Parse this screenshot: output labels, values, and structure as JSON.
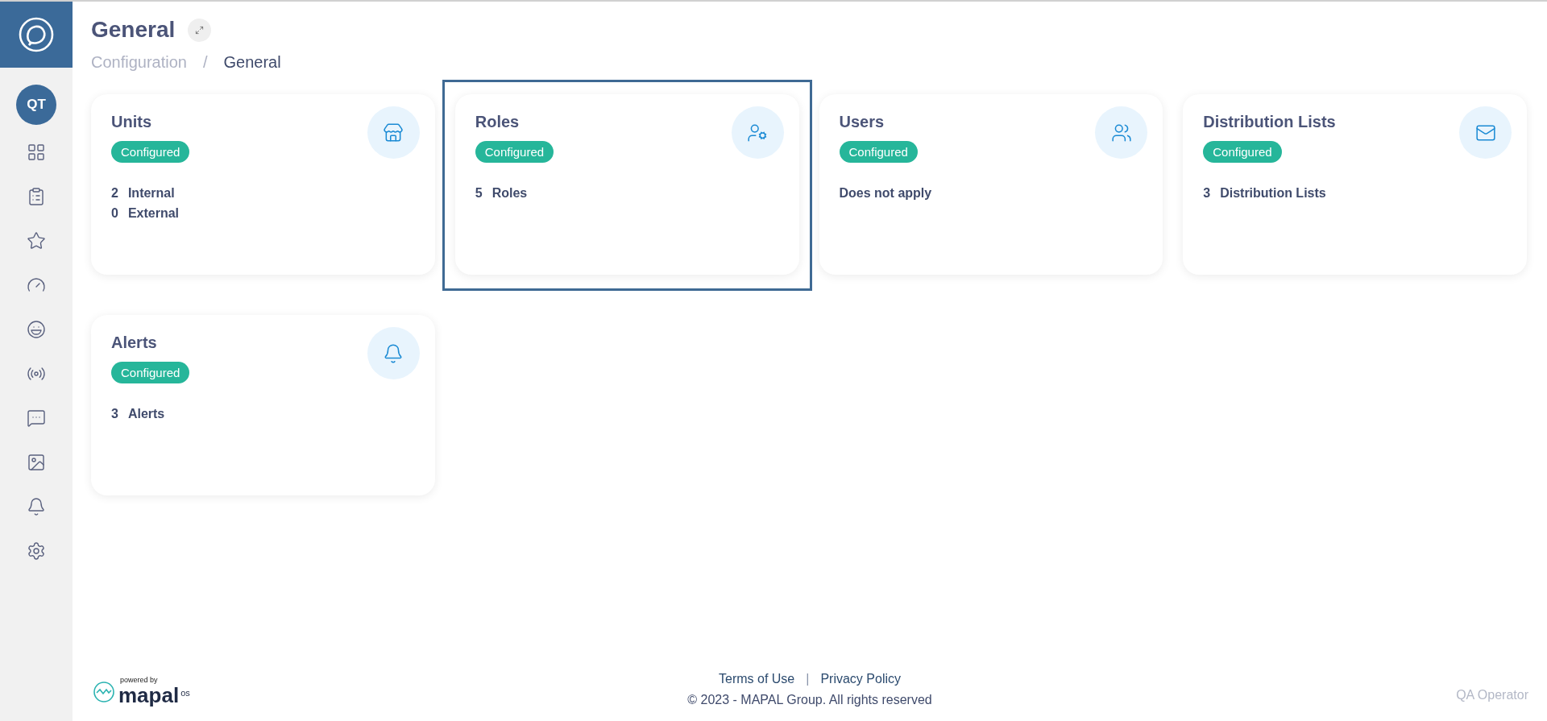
{
  "user": {
    "initials": "QT"
  },
  "header": {
    "title": "General",
    "breadcrumb": [
      {
        "label": "Configuration",
        "current": false
      },
      {
        "label": "/",
        "current": false
      },
      {
        "label": "General",
        "current": true
      }
    ]
  },
  "cards": [
    {
      "title": "Units",
      "status": "Configured",
      "selected": false,
      "lines": [
        {
          "kind": "count",
          "count": "2",
          "label": "Internal"
        },
        {
          "kind": "count",
          "count": "0",
          "label": "External"
        }
      ]
    },
    {
      "title": "Roles",
      "status": "Configured",
      "selected": true,
      "lines": [
        {
          "kind": "count",
          "count": "5",
          "label": "Roles"
        }
      ]
    },
    {
      "title": "Users",
      "status": "Configured",
      "selected": false,
      "lines": [
        {
          "kind": "note",
          "label": "Does not apply"
        }
      ]
    },
    {
      "title": "Distribution Lists",
      "status": "Configured",
      "selected": false,
      "lines": [
        {
          "kind": "count",
          "count": "3",
          "label": "Distribution Lists"
        }
      ]
    },
    {
      "title": "Alerts",
      "status": "Configured",
      "selected": false,
      "lines": [
        {
          "kind": "count",
          "count": "3",
          "label": "Alerts"
        }
      ]
    }
  ],
  "footer": {
    "powered_by": "powered by",
    "brand": "mapal",
    "brand_suffix": "os",
    "links": [
      "Terms of Use",
      "|",
      "Privacy Policy"
    ],
    "copyright": "© 2023 - MAPAL Group. All rights reserved",
    "user_name": "QA Operator"
  }
}
